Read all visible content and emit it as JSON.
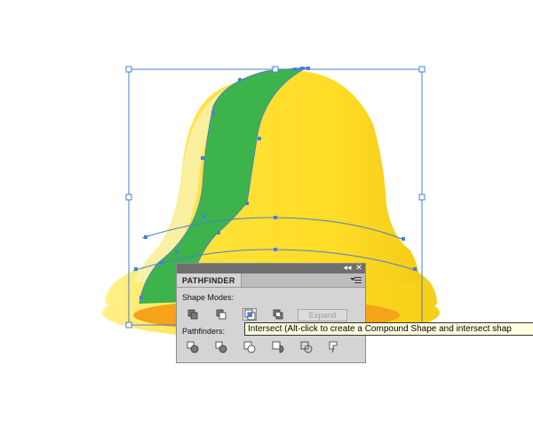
{
  "artwork": {
    "colors": {
      "bell_yellow": "#ffdf2a",
      "bell_highlight": "#fbf1a8",
      "bell_shadow": "#f2c81a",
      "stripe_green": "#3cb44b",
      "rim_orange": "#f6a21a",
      "selection_blue": "#4a7fd0"
    }
  },
  "panel": {
    "title": "PATHFINDER",
    "collapse_icon": "double-arrow-icon",
    "close_icon": "close-icon",
    "shape_modes_label": "Shape Modes:",
    "shape_modes": [
      {
        "name": "add-to-shape-area-icon"
      },
      {
        "name": "subtract-from-shape-area-icon"
      },
      {
        "name": "intersect-shape-areas-icon"
      },
      {
        "name": "exclude-overlapping-shape-areas-icon"
      }
    ],
    "expand_label": "Expand",
    "pathfinders_label": "Pathfinders:",
    "pathfinders": [
      {
        "name": "divide-icon"
      },
      {
        "name": "trim-icon"
      },
      {
        "name": "merge-icon"
      },
      {
        "name": "crop-icon"
      },
      {
        "name": "outline-icon"
      },
      {
        "name": "minus-back-icon"
      }
    ]
  },
  "tooltip": {
    "text": "Intersect (Alt-click to create a Compound Shape and intersect shap"
  }
}
